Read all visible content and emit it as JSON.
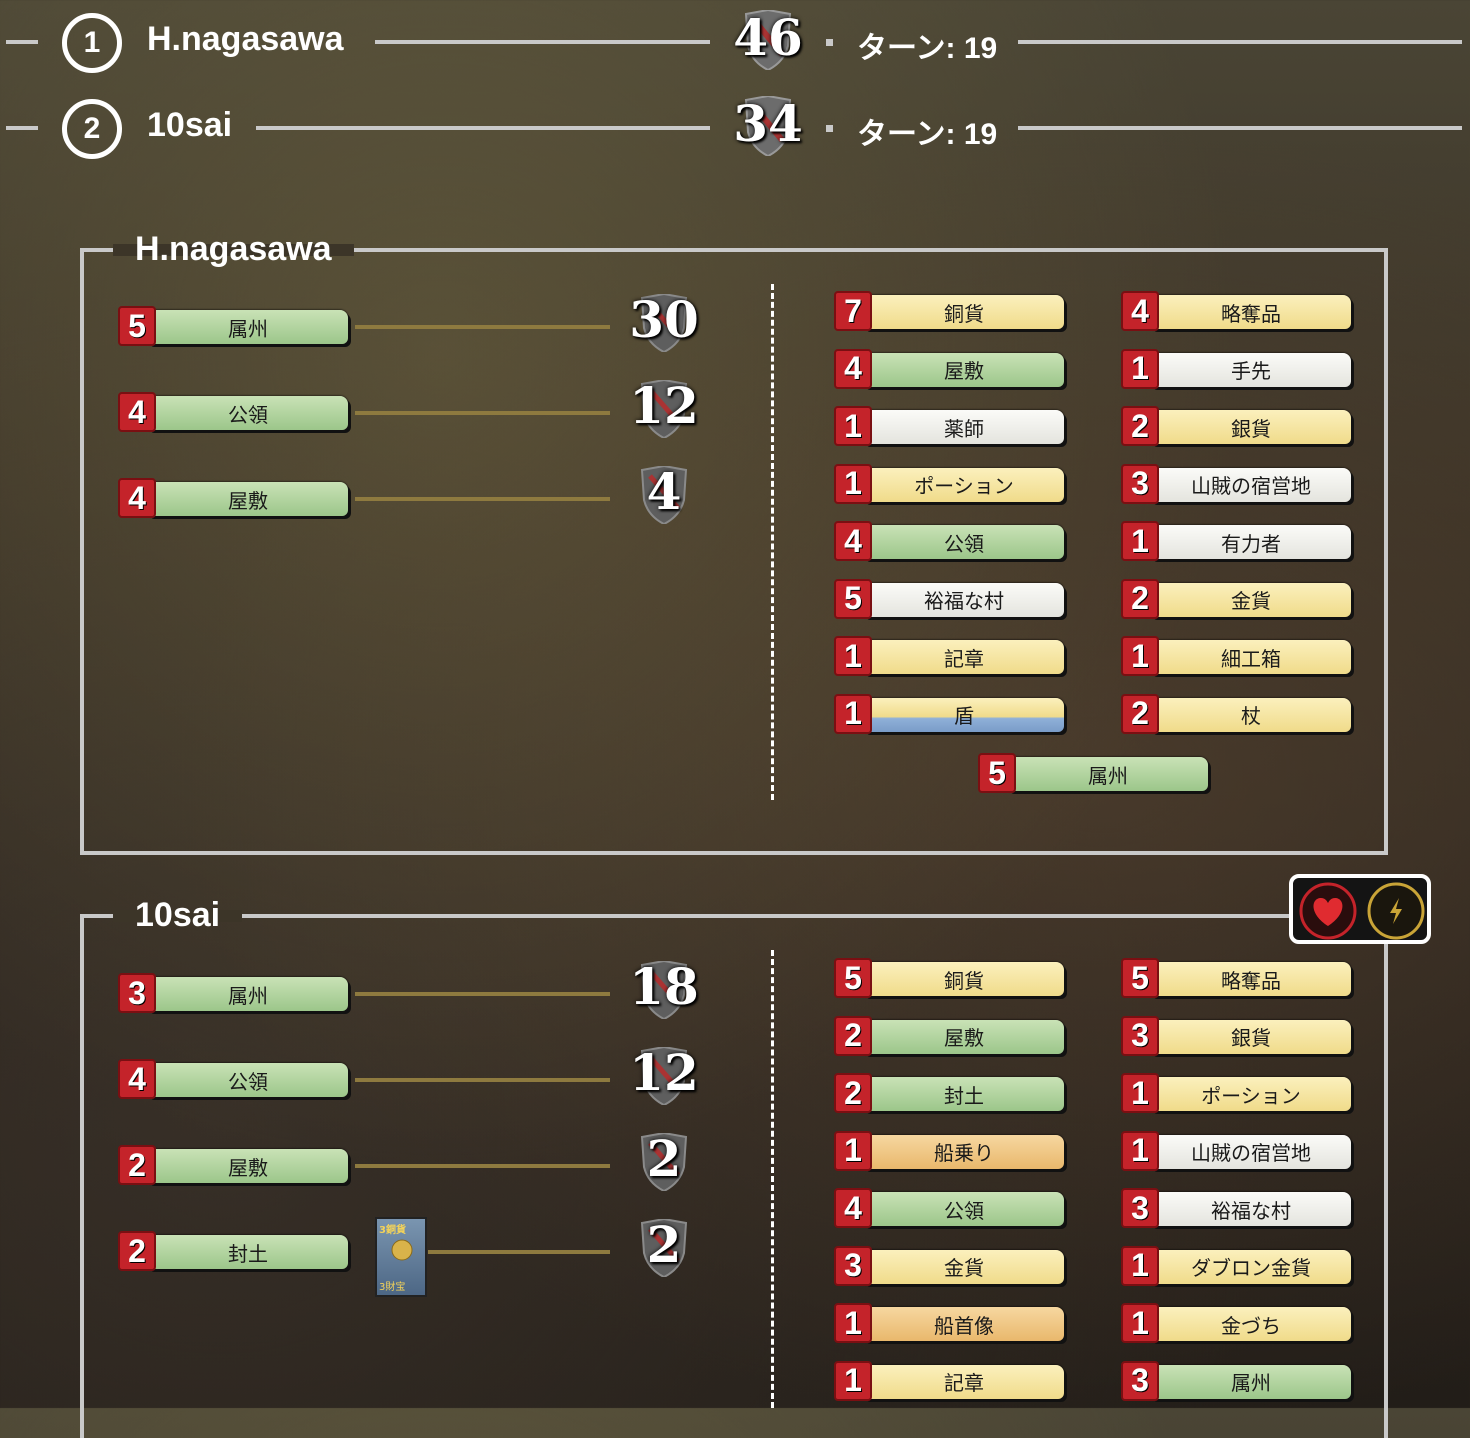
{
  "ranking": [
    {
      "rank": "1",
      "name": "H.nagasawa",
      "score": "46",
      "turn": "ターン: 19"
    },
    {
      "rank": "2",
      "name": "10sai",
      "score": "34",
      "turn": "ターン: 19"
    }
  ],
  "players": [
    {
      "name": "H.nagasawa",
      "vp_rows": [
        {
          "count": "5",
          "card": "属州",
          "color": "green",
          "vp": "30"
        },
        {
          "count": "4",
          "card": "公領",
          "color": "green",
          "vp": "12"
        },
        {
          "count": "4",
          "card": "屋敷",
          "color": "green",
          "vp": "4"
        }
      ],
      "deck": [
        {
          "count": "7",
          "card": "銅貨",
          "color": "yellow"
        },
        {
          "count": "4",
          "card": "略奪品",
          "color": "yellow"
        },
        {
          "count": "4",
          "card": "屋敷",
          "color": "green"
        },
        {
          "count": "1",
          "card": "手先",
          "color": "white"
        },
        {
          "count": "1",
          "card": "薬師",
          "color": "white"
        },
        {
          "count": "2",
          "card": "銀貨",
          "color": "yellow"
        },
        {
          "count": "1",
          "card": "ポーション",
          "color": "yellow"
        },
        {
          "count": "3",
          "card": "山賊の宿営地",
          "color": "white"
        },
        {
          "count": "4",
          "card": "公領",
          "color": "green"
        },
        {
          "count": "1",
          "card": "有力者",
          "color": "white"
        },
        {
          "count": "5",
          "card": "裕福な村",
          "color": "white"
        },
        {
          "count": "2",
          "card": "金貨",
          "color": "yellow"
        },
        {
          "count": "1",
          "card": "記章",
          "color": "yellow"
        },
        {
          "count": "1",
          "card": "細工箱",
          "color": "yellow"
        },
        {
          "count": "1",
          "card": "盾",
          "color": "yellowblue"
        },
        {
          "count": "2",
          "card": "杖",
          "color": "yellow"
        },
        {
          "count": "5",
          "card": "属州",
          "color": "green"
        }
      ]
    },
    {
      "name": "10sai",
      "vp_rows": [
        {
          "count": "3",
          "card": "属州",
          "color": "green",
          "vp": "18"
        },
        {
          "count": "4",
          "card": "公領",
          "color": "green",
          "vp": "12"
        },
        {
          "count": "2",
          "card": "屋敷",
          "color": "green",
          "vp": "2"
        },
        {
          "count": "2",
          "card": "封土",
          "color": "green",
          "vp": "2"
        }
      ],
      "deck": [
        {
          "count": "5",
          "card": "銅貨",
          "color": "yellow"
        },
        {
          "count": "5",
          "card": "略奪品",
          "color": "yellow"
        },
        {
          "count": "2",
          "card": "屋敷",
          "color": "green"
        },
        {
          "count": "3",
          "card": "銀貨",
          "color": "yellow"
        },
        {
          "count": "2",
          "card": "封土",
          "color": "green"
        },
        {
          "count": "1",
          "card": "ポーション",
          "color": "yellow"
        },
        {
          "count": "1",
          "card": "船乗り",
          "color": "orange"
        },
        {
          "count": "1",
          "card": "山賊の宿営地",
          "color": "white"
        },
        {
          "count": "4",
          "card": "公領",
          "color": "green"
        },
        {
          "count": "3",
          "card": "裕福な村",
          "color": "white"
        },
        {
          "count": "3",
          "card": "金貨",
          "color": "yellow"
        },
        {
          "count": "1",
          "card": "ダブロン金貨",
          "color": "yellow"
        },
        {
          "count": "1",
          "card": "船首像",
          "color": "orange"
        },
        {
          "count": "1",
          "card": "金づち",
          "color": "yellow"
        },
        {
          "count": "1",
          "card": "記章",
          "color": "yellow"
        },
        {
          "count": "3",
          "card": "属州",
          "color": "green"
        }
      ],
      "mini_card": {
        "label_top": "3銅貨",
        "label_bottom": "3財宝"
      }
    }
  ],
  "icons": [
    "heart-icon",
    "lightning-icon"
  ]
}
